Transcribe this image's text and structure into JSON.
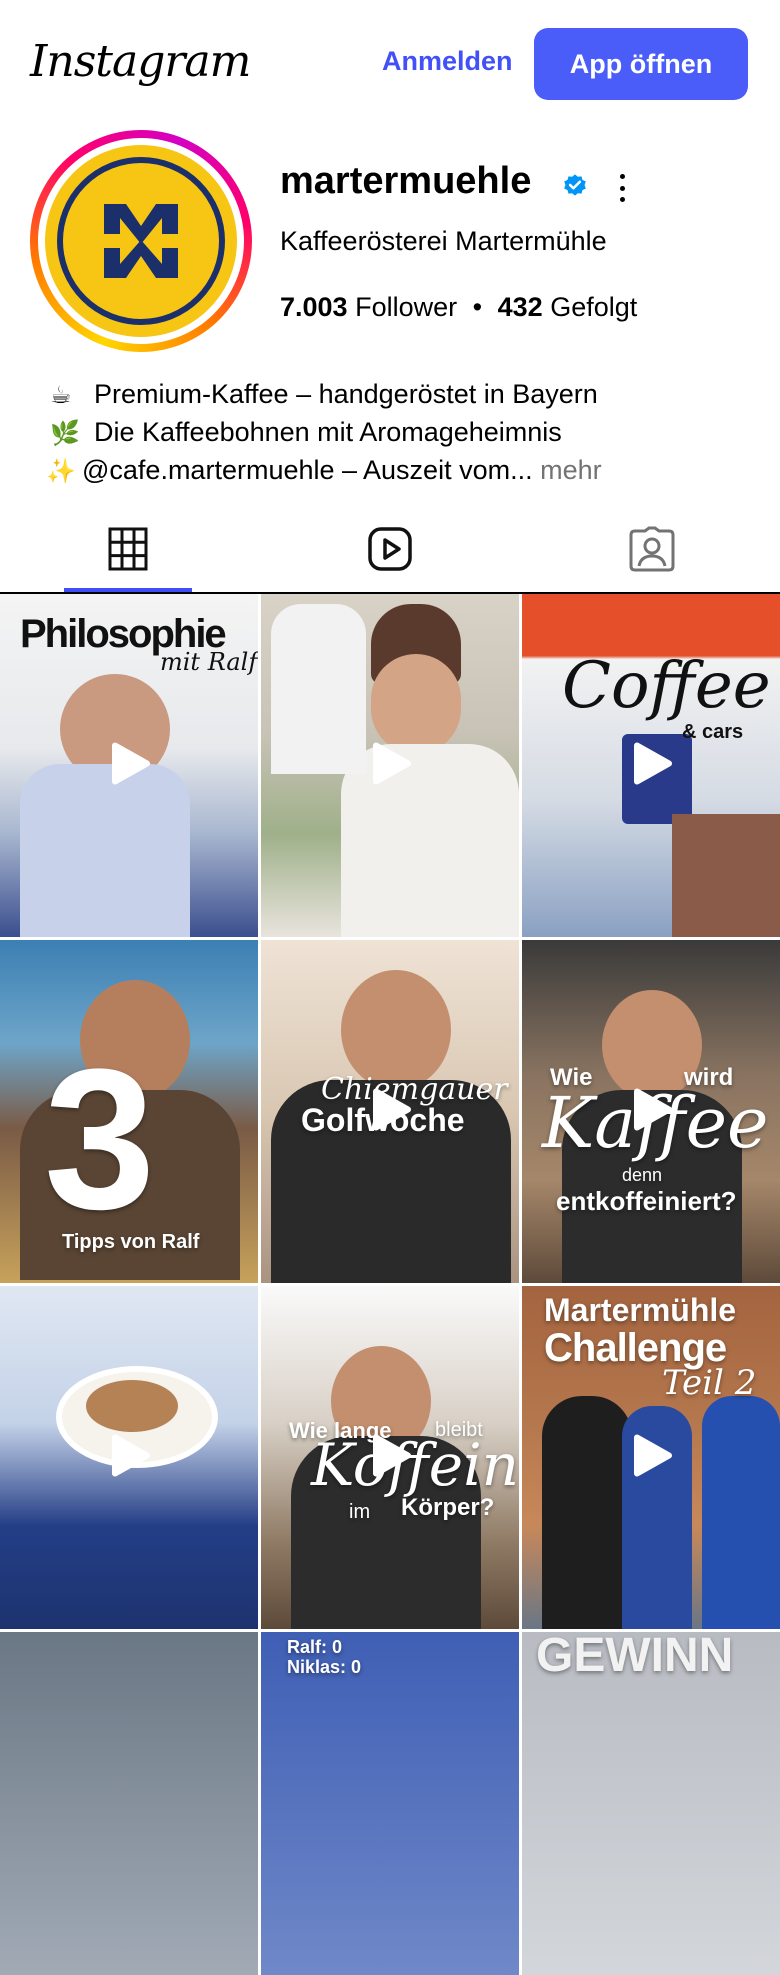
{
  "header": {
    "logo_text": "Instagram",
    "login_label": "Anmelden",
    "open_app_label": "App öffnen"
  },
  "profile": {
    "username": "martermuehle",
    "full_name": "Kaffeerösterei Martermühle",
    "followers_count": "7.003",
    "followers_label": "Follower",
    "separator": "•",
    "following_count": "432",
    "following_label": "Gefolgt",
    "bio": [
      {
        "emoji": "☕",
        "text": "Premium-Kaffee – handgeröstet in Bayern"
      },
      {
        "emoji": "🌿",
        "text": "Die Kaffeebohnen mit Aromageheimnis"
      },
      {
        "emoji": "✨",
        "text": "@cafe.martermuehle – Auszeit vom..."
      }
    ],
    "more_label": "mehr"
  },
  "tabs": [
    {
      "icon": "grid-icon",
      "active": true
    },
    {
      "icon": "reels-icon",
      "active": false
    },
    {
      "icon": "tagged-icon",
      "active": false
    }
  ],
  "posts": [
    {
      "caption_1": "Philosophie",
      "caption_2": "mit Ralf"
    },
    {
      "caption_1": "",
      "caption_2": ""
    },
    {
      "caption_1": "Coffee",
      "caption_2": "& cars"
    },
    {
      "caption_1": "3",
      "caption_2": "Tipps von Ralf"
    },
    {
      "caption_1": "Chiemgauer",
      "caption_2": "Golfwoche"
    },
    {
      "caption_1": "Wie",
      "caption_2": "wird",
      "caption_3": "Kaffee",
      "caption_4": "denn",
      "caption_5": "entkoffeiniert?"
    },
    {
      "caption_1": "",
      "caption_2": ""
    },
    {
      "caption_1": "Wie lange",
      "caption_2": "bleibt",
      "caption_3": "Koffein",
      "caption_4": "im",
      "caption_5": "Körper?"
    },
    {
      "caption_1": "Martermühle",
      "caption_2": "Challenge",
      "caption_3": "Teil 2"
    },
    {
      "caption_1": "",
      "caption_2": ""
    },
    {
      "caption_1": "Ralf: 0",
      "caption_2": "Niklas: 0"
    },
    {
      "caption_1": "GEWINN",
      "caption_2": ""
    }
  ],
  "colors": {
    "accent": "#4a5df9",
    "link": "#4150f7",
    "avatar_bg": "#f7c614",
    "avatar_navy": "#1b2f6b",
    "verified": "#0095f6"
  }
}
